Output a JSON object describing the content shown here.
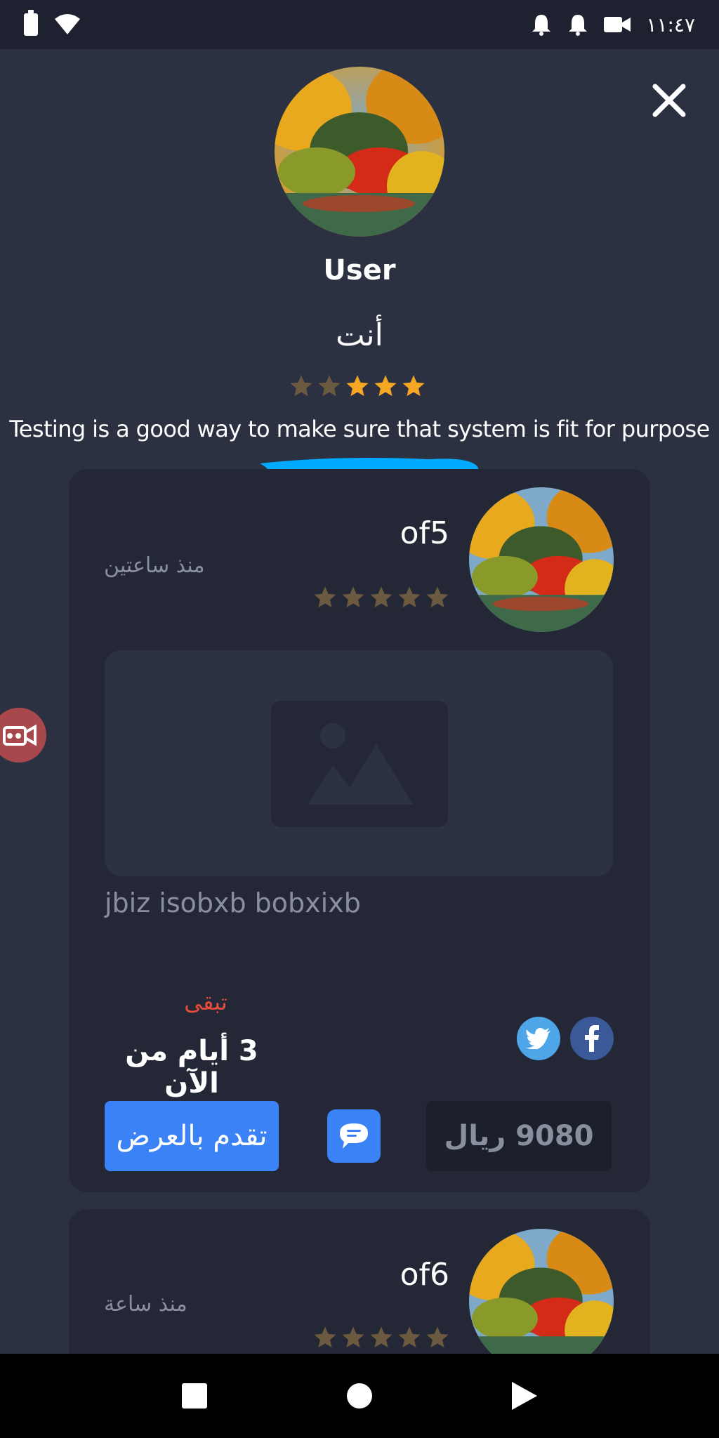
{
  "status_bar": {
    "time": "١١:٤٧",
    "icons": [
      "battery-icon",
      "wifi-icon",
      "notification-icon",
      "notification-icon",
      "video-camera-icon"
    ]
  },
  "profile": {
    "name": "User",
    "subtitle": "أنت",
    "rating": 3,
    "bio": "Testing is a good way to make sure that system is fit for purpose"
  },
  "colors": {
    "background": "#2c3142",
    "card": "#242836",
    "accent": "#3b82f6",
    "star_active": "#f5a623",
    "star_inactive": "#6b5a3f",
    "remaining": "#e74c3c",
    "twitter": "#4ea6e8",
    "facebook": "#3b5998"
  },
  "cards": [
    {
      "title": "of5",
      "time": "منذ ساعتين",
      "rating": 0,
      "description": "jbiz isobxb bobxixb",
      "remaining_label": "تبقى",
      "remaining_value": "3 أيام من الآن",
      "bid_label": "تقدم بالعرض",
      "price": "9080 ريال"
    },
    {
      "title": "of6",
      "time": "منذ ساعة",
      "rating": 0
    }
  ]
}
